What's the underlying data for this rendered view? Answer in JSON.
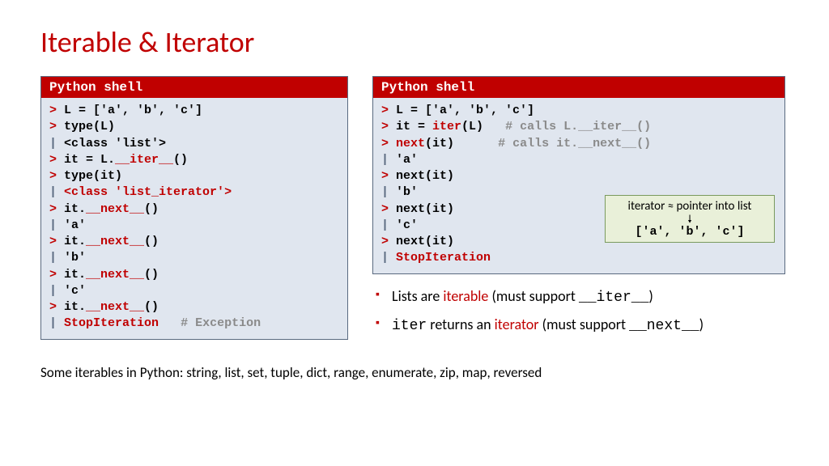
{
  "title": "Iterable  & Iterator",
  "shell_header": "Python shell",
  "left_shell": {
    "lines": [
      {
        "p": ">",
        "segs": [
          {
            "text": " L = ['a', 'b', 'c']",
            "cls": "black"
          }
        ]
      },
      {
        "p": ">",
        "segs": [
          {
            "text": " type(L)",
            "cls": "black"
          }
        ]
      },
      {
        "p": "|",
        "segs": [
          {
            "text": " <class 'list'>",
            "cls": "black"
          }
        ]
      },
      {
        "p": ">",
        "segs": [
          {
            "text": " it = L.",
            "cls": "black"
          },
          {
            "text": "__iter__",
            "cls": "red"
          },
          {
            "text": "()",
            "cls": "black"
          }
        ]
      },
      {
        "p": ">",
        "segs": [
          {
            "text": " type(it)",
            "cls": "black"
          }
        ]
      },
      {
        "p": "|",
        "segs": [
          {
            "text": " ",
            "cls": "black"
          },
          {
            "text": "<class 'list_iterator'>",
            "cls": "red"
          }
        ]
      },
      {
        "p": ">",
        "segs": [
          {
            "text": " it.",
            "cls": "black"
          },
          {
            "text": "__next__",
            "cls": "red"
          },
          {
            "text": "()",
            "cls": "black"
          }
        ]
      },
      {
        "p": "|",
        "segs": [
          {
            "text": " 'a'",
            "cls": "black"
          }
        ]
      },
      {
        "p": ">",
        "segs": [
          {
            "text": " it.",
            "cls": "black"
          },
          {
            "text": "__next__",
            "cls": "red"
          },
          {
            "text": "()",
            "cls": "black"
          }
        ]
      },
      {
        "p": "|",
        "segs": [
          {
            "text": " 'b'",
            "cls": "black"
          }
        ]
      },
      {
        "p": ">",
        "segs": [
          {
            "text": " it.",
            "cls": "black"
          },
          {
            "text": "__next__",
            "cls": "red"
          },
          {
            "text": "()",
            "cls": "black"
          }
        ]
      },
      {
        "p": "|",
        "segs": [
          {
            "text": " 'c'",
            "cls": "black"
          }
        ]
      },
      {
        "p": ">",
        "segs": [
          {
            "text": " it.",
            "cls": "black"
          },
          {
            "text": "__next__",
            "cls": "red"
          },
          {
            "text": "()",
            "cls": "black"
          }
        ]
      },
      {
        "p": "|",
        "segs": [
          {
            "text": " ",
            "cls": "black"
          },
          {
            "text": "StopIteration",
            "cls": "red"
          },
          {
            "text": "   # Exception",
            "cls": "grey"
          }
        ]
      }
    ]
  },
  "right_shell": {
    "lines": [
      {
        "p": ">",
        "segs": [
          {
            "text": " L = ['a', 'b', 'c']",
            "cls": "black"
          }
        ]
      },
      {
        "p": ">",
        "segs": [
          {
            "text": " it = ",
            "cls": "black"
          },
          {
            "text": "iter",
            "cls": "red"
          },
          {
            "text": "(L)   ",
            "cls": "black"
          },
          {
            "text": "# calls L.__iter__()",
            "cls": "grey"
          }
        ]
      },
      {
        "p": ">",
        "segs": [
          {
            "text": " ",
            "cls": "black"
          },
          {
            "text": "next",
            "cls": "red"
          },
          {
            "text": "(it)      ",
            "cls": "black"
          },
          {
            "text": "# calls it.__next__()",
            "cls": "grey"
          }
        ]
      },
      {
        "p": "|",
        "segs": [
          {
            "text": " 'a'",
            "cls": "black"
          }
        ]
      },
      {
        "p": ">",
        "segs": [
          {
            "text": " next(it)",
            "cls": "black"
          }
        ]
      },
      {
        "p": "|",
        "segs": [
          {
            "text": " 'b'",
            "cls": "black"
          }
        ]
      },
      {
        "p": ">",
        "segs": [
          {
            "text": " next(it)",
            "cls": "black"
          }
        ]
      },
      {
        "p": "|",
        "segs": [
          {
            "text": " 'c'",
            "cls": "black"
          }
        ]
      },
      {
        "p": ">",
        "segs": [
          {
            "text": " next(it)",
            "cls": "black"
          }
        ]
      },
      {
        "p": "|",
        "segs": [
          {
            "text": " ",
            "cls": "black"
          },
          {
            "text": "StopIteration",
            "cls": "red"
          }
        ]
      }
    ]
  },
  "note": {
    "caption": "iterator ≈ pointer into list",
    "list": "['a', 'b', 'c']"
  },
  "bullets": [
    {
      "segs": [
        {
          "t": "Lists are "
        },
        {
          "t": "iterable",
          "cls": "red"
        },
        {
          "t": " (must support "
        },
        {
          "t": "__iter__",
          "cls": "mono-inline"
        },
        {
          "t": ")"
        }
      ]
    },
    {
      "segs": [
        {
          "t": "iter",
          "cls": "mono-inline"
        },
        {
          "t": " returns an "
        },
        {
          "t": "iterator",
          "cls": "red"
        },
        {
          "t": " (must support "
        },
        {
          "t": "__next__",
          "cls": "mono-inline"
        },
        {
          "t": ")"
        }
      ]
    }
  ],
  "footer": "Some iterables in Python: string, list, set, tuple, dict, range, enumerate, zip, map, reversed"
}
